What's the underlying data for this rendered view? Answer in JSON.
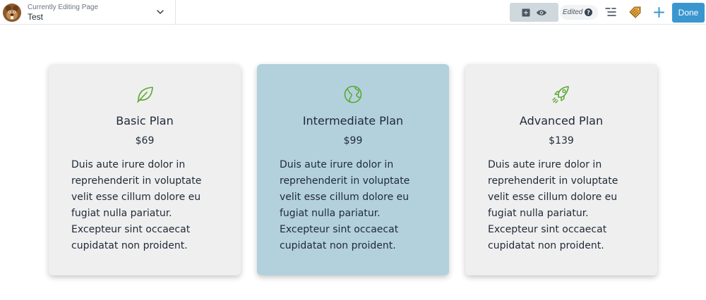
{
  "topbar": {
    "page_switcher": {
      "caption": "Currently Editing Page",
      "title": "Test"
    },
    "status": "Edited",
    "done_label": "Done"
  },
  "colors": {
    "accent": "#3a96cf",
    "icon_green": "#5aa832",
    "card_default": "#efefef",
    "card_featured": "#b3d1dc"
  },
  "plans": [
    {
      "icon": "leaf-icon",
      "name": "Basic Plan",
      "price": "$69",
      "description": "Duis aute irure dolor in reprehenderit in voluptate velit esse cillum dolore eu fugiat nulla pariatur. Excepteur sint occaecat cupidatat non proident."
    },
    {
      "icon": "globe-icon",
      "name": "Intermediate Plan",
      "price": "$99",
      "description": "Duis aute irure dolor in reprehenderit in voluptate velit esse cillum dolore eu fugiat nulla pariatur. Excepteur sint occaecat cupidatat non proident."
    },
    {
      "icon": "rocket-icon",
      "name": "Advanced Plan",
      "price": "$139",
      "description": "Duis aute irure dolor in reprehenderit in voluptate velit esse cillum dolore eu fugiat nulla pariatur. Excepteur sint occaecat cupidatat non proident."
    }
  ]
}
